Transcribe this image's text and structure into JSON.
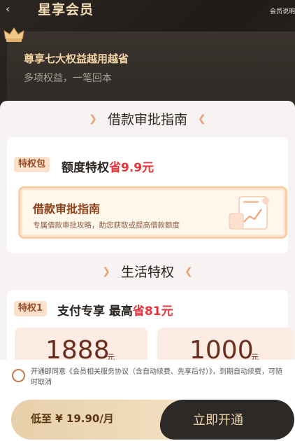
{
  "nav": {
    "back_icon": "chevron-left-icon",
    "title": "星享会员",
    "explain": "会员说明"
  },
  "hero": {
    "title": "尊享七大权益越用越省",
    "subtitle": "多项权益，一笔回本",
    "crown_icon": "crown-icon"
  },
  "section1": {
    "title": "借款审批指南"
  },
  "card1": {
    "tag": "特权包",
    "title_prefix": "额度特权",
    "title_save": "省9.9元",
    "guide_title": "借款审批指南",
    "guide_desc": "专属借款审批攻略，助您获取或提高借款额度"
  },
  "section2": {
    "title": "生活特权"
  },
  "card2": {
    "tag": "特权1",
    "title_prefix": "支付专享 最高",
    "title_save": "省81元",
    "prices": [
      {
        "amount": "1888",
        "unit": "元"
      },
      {
        "amount": "1000",
        "unit": "元"
      }
    ]
  },
  "agreement": {
    "text": "开通即同意《会员相关服务协议（含自动续费、先享后付）》，到期自动续费，可随时取消"
  },
  "bottom": {
    "price_label": "低至 ¥ 19.90/月",
    "open_label": "立即开通"
  },
  "colors": {
    "accent": "#e5343b",
    "gold": "#f3dcb6",
    "dark": "#2d2927"
  }
}
